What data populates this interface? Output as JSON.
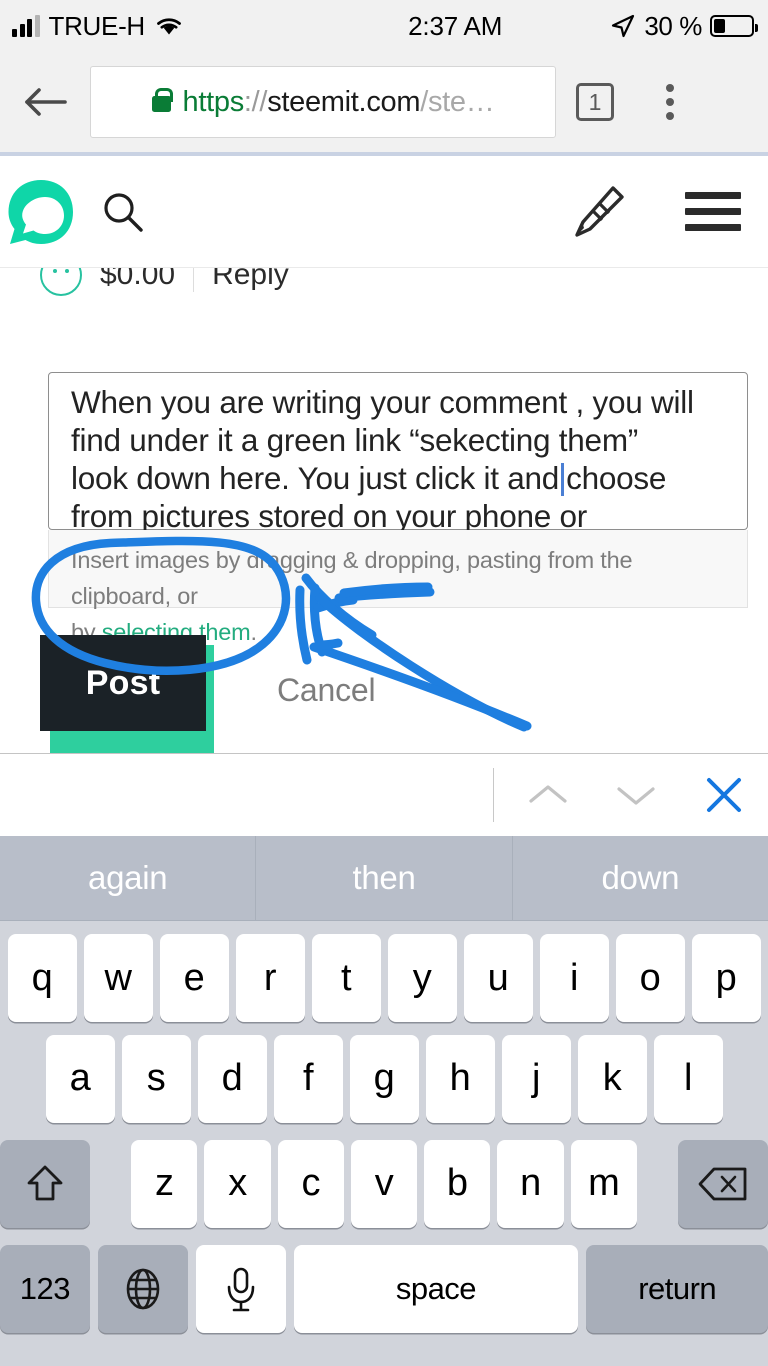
{
  "status_bar": {
    "carrier": "TRUE-H",
    "time": "2:37 AM",
    "battery_pct": "30 %",
    "battery_level": 30,
    "signal_icon": "cellular-signal-icon",
    "wifi_icon": "wifi-icon",
    "location_icon": "location-arrow-icon",
    "battery_icon": "battery-icon"
  },
  "browser": {
    "back_icon": "back-arrow-icon",
    "lock_icon": "lock-icon",
    "url_scheme": "https",
    "url_separator": "://",
    "url_host": "steemit.com",
    "url_path": "/ste…",
    "tab_count": "1",
    "tabs_icon": "tabs-icon",
    "menu_icon": "overflow-menu-icon"
  },
  "site_header": {
    "logo_icon": "steemit-logo-icon",
    "search_icon": "search-icon",
    "compose_icon": "pencil-compose-icon",
    "menu_icon": "hamburger-menu-icon",
    "logo_color": "#0fd6a8"
  },
  "reply_bar": {
    "payout_icon": "payout-circle-icon",
    "payout_amount": "$0.00",
    "reply_label": "Reply"
  },
  "comment_editor": {
    "value_line1": "When you are writing your comment , you will",
    "value_line2": "find under it a green link “sekecting them”",
    "value_line3a": "look down here. You just click it and",
    "value_line3b": "choose",
    "value_line4": "from pictures stored on your phone or",
    "caret_visible": true
  },
  "editor_hint": {
    "line1": "Insert images by dragging & dropping, pasting from the clipboard, or",
    "line2_prefix": "by ",
    "line2_link": "selecting them",
    "line2_suffix": ".",
    "link_color": "#23ac7f"
  },
  "actions": {
    "post_label": "Post",
    "cancel_label": "Cancel",
    "post_bg": "#1b2227",
    "post_shadow": "#2ecf9e"
  },
  "annotation": {
    "color": "#1f7fe0",
    "shapes": "hand-drawn blue ellipse around hint text with arrows pointing at it"
  },
  "keyboard_accessory": {
    "prev_icon": "chevron-up-icon",
    "next_icon": "chevron-down-icon",
    "close_icon": "close-x-icon",
    "close_color": "#1577e0",
    "chevron_color": "#c3c3c3"
  },
  "keyboard": {
    "suggestions": [
      "again",
      "then",
      "down"
    ],
    "row1": [
      "q",
      "w",
      "e",
      "r",
      "t",
      "y",
      "u",
      "i",
      "o",
      "p"
    ],
    "row2": [
      "a",
      "s",
      "d",
      "f",
      "g",
      "h",
      "j",
      "k",
      "l"
    ],
    "row3": [
      "z",
      "x",
      "c",
      "v",
      "b",
      "n",
      "m"
    ],
    "shift_icon": "shift-arrow-icon",
    "backspace_icon": "backspace-delete-icon",
    "numeric_label": "123",
    "globe_icon": "globe-language-icon",
    "mic_icon": "microphone-icon",
    "space_label": "space",
    "return_label": "return"
  }
}
